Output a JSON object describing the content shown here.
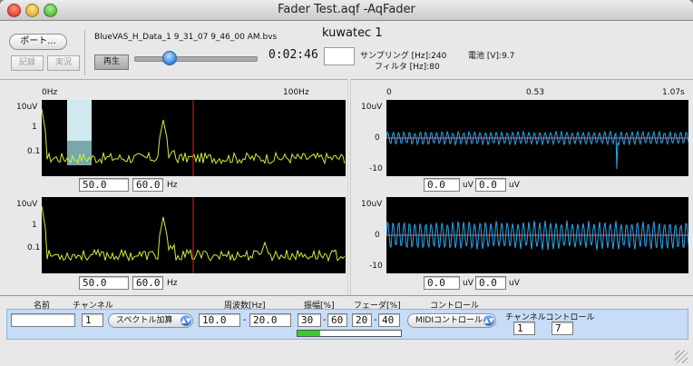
{
  "window": {
    "title": "Fader Test.aqf -AqFader"
  },
  "toolbar": {
    "port_button": "ポート...",
    "record_button": "記録",
    "live_button": "実況",
    "play_button": "再生",
    "file_name": "BlueVAS_H_Data_1 9_31_07 9_46_00 AM.bvs",
    "time": "0:02:46",
    "playback_position": 0.28,
    "device_name": "kuwatec 1",
    "sampling_label": "サンプリング [Hz]:",
    "sampling_value": "240",
    "filter_label": "フィルタ [Hz]:",
    "filter_value": "80",
    "battery_label": "電池 [V]:",
    "battery_value": "9.7"
  },
  "spectrum": {
    "x_start": "0Hz",
    "x_end": "100Hz",
    "y_labels": [
      "10uV",
      "1",
      "0.1"
    ],
    "plot1": {
      "low": "50.0",
      "high": "60.0",
      "unit": "Hz"
    },
    "plot2": {
      "low": "50.0",
      "high": "60.0",
      "unit": "Hz"
    },
    "colors": {
      "trace": "#c8f03c",
      "marker": "#e02020",
      "band": "#cfe9ee"
    }
  },
  "waveform": {
    "x_start": "0",
    "x_mid": "0.53",
    "x_end": "1.07s",
    "y_labels": [
      "10uV",
      "0",
      "-10"
    ],
    "plot1": {
      "a": "0.0",
      "unit_a": "uV",
      "b": "0.0",
      "unit_b": "uV"
    },
    "plot2": {
      "a": "0.0",
      "unit_a": "uV",
      "b": "0.0",
      "unit_b": "uV"
    },
    "colors": {
      "trace": "#2aa7f0",
      "zero_line": "#ff6a6a"
    }
  },
  "table": {
    "headers": {
      "name": "名前",
      "channel": "チャンネル",
      "frequency": "周波数[Hz]",
      "amplitude": "振幅[%]",
      "fader": "フェーダ[%]",
      "control": "コントロール",
      "channel_control": "チャンネルコントロール"
    },
    "row": {
      "name": "",
      "channel": "1",
      "mode": "スペクトル加算",
      "freq_low": "10.0",
      "freq_high": "20.0",
      "amp_low": "30",
      "amp_high": "60",
      "fader_low": "20",
      "fader_high": "40",
      "control": "MIDIコントロール",
      "chan_ctrl_a": "1",
      "chan_ctrl_b": "7",
      "level": 0.22,
      "level_color": "#3ccc2a"
    }
  }
}
